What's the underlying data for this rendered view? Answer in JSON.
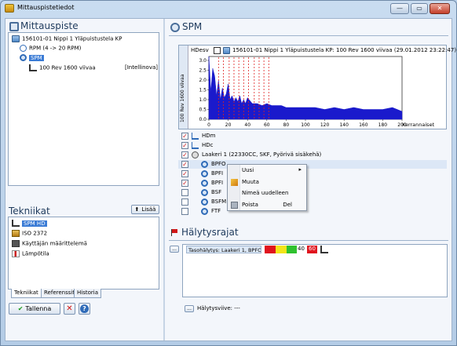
{
  "window": {
    "title": "Mittauspistetiedot",
    "min_glyph": "—",
    "max_glyph": "▭",
    "close_glyph": "✕"
  },
  "measurement_point": {
    "heading": "Mittauspiste",
    "tree": [
      {
        "label": "156101-01  Nippi 1 Yläpuistustela KP",
        "icon": "folder-icon"
      },
      {
        "label": "RPM   (4 -> 20 RPM)",
        "icon": "rpm-icon"
      },
      {
        "label": "SPM",
        "icon": "gear-icon"
      },
      {
        "label": "100 Rev 1600 viivaa",
        "suffix": "[Intellinova]",
        "icon": "chart-icon"
      }
    ]
  },
  "techniques": {
    "heading": "Tekniikat",
    "add_label": "Lisää",
    "items": [
      {
        "label": "SPM HD",
        "icon": "chart-icon",
        "selected": true
      },
      {
        "label": "ISO 2372",
        "icon": "iso-icon",
        "selected": false
      },
      {
        "label": "Käyttäjän määrittelemä",
        "icon": "keyboard-icon",
        "selected": false
      },
      {
        "label": "Lämpötila",
        "icon": "thermometer-icon",
        "selected": false
      }
    ],
    "tabs": [
      "Tekniikat",
      "Referenssit",
      "Historia"
    ]
  },
  "footer": {
    "save_label": "Tallenna",
    "cancel_glyph": "✕",
    "help_glyph": "?"
  },
  "spm": {
    "heading": "SPM",
    "chart_title": "156101-01  Nippi 1 Yläpuistustela KP: 100 Rev 1600 viivaa (29.01.2012 23:22:47)",
    "chart_corner_label": "HDesv",
    "y_axis_label": "100 Rev 1600 viivaa",
    "x_axis_label": "Kerrannaiset",
    "params": [
      {
        "label": "HDm",
        "checked": true,
        "indent": 0,
        "icon": "wave-icon"
      },
      {
        "label": "HDc",
        "checked": true,
        "indent": 0,
        "icon": "wave-icon"
      },
      {
        "label": "Laakeri 1 (22330CC, SKF, Pyörivä sisäkehä)",
        "checked": true,
        "indent": 0,
        "icon": "bearing-icon"
      },
      {
        "label": "BPFO",
        "checked": true,
        "indent": 1,
        "icon": "gear-icon",
        "highlight": true
      },
      {
        "label": "BPFI",
        "checked": true,
        "indent": 1,
        "icon": "gear-icon"
      },
      {
        "label": "BPFI",
        "checked": true,
        "indent": 1,
        "icon": "gear-icon"
      },
      {
        "label": "BSF",
        "checked": false,
        "indent": 1,
        "icon": "gear-icon"
      },
      {
        "label": "BSFM",
        "checked": false,
        "indent": 1,
        "icon": "gear-icon"
      },
      {
        "label": "FTF",
        "checked": false,
        "indent": 1,
        "icon": "gear-icon"
      }
    ],
    "context_menu": [
      {
        "label": "Uusi",
        "shortcut": "",
        "submenu": true,
        "icon": ""
      },
      {
        "label": "Muuta",
        "shortcut": "",
        "submenu": false,
        "icon": "edit-icon"
      },
      {
        "label": "Nimeä uudelleen",
        "shortcut": "",
        "submenu": false,
        "icon": ""
      },
      {
        "label": "Poista",
        "shortcut": "Del",
        "submenu": false,
        "icon": "trash-icon"
      }
    ]
  },
  "alarm": {
    "heading": "Hälytysrajat",
    "row_label": "Tasohälytys: Laakeri 1, BPFO",
    "level_1": "40",
    "level_2": "60",
    "more_glyph": "...",
    "level_caption": "Hälytysviive: ---",
    "colors": {
      "red": "#e0141e",
      "yellow": "#f2e41a",
      "green": "#2fc12f",
      "level_2_bg": "#e0141e"
    }
  },
  "chart_data": {
    "type": "line",
    "title": "156101-01  Nippi 1 Yläpuistustela KP: 100 Rev 1600 viivaa (29.01.2012 23:22:47)",
    "xlabel": "Kerrannaiset",
    "ylabel": "100 Rev 1600 viivaa",
    "xlim": [
      0,
      200
    ],
    "ylim": [
      0,
      3.2
    ],
    "x_ticks": [
      0,
      20,
      40,
      60,
      80,
      100,
      120,
      140,
      160,
      180,
      200
    ],
    "y_ticks": [
      0,
      0.5,
      1.0,
      1.5,
      2.0,
      2.5,
      3.0
    ],
    "series": [
      {
        "color": "#1a1acc",
        "x": [
          0,
          2,
          4,
          6,
          8,
          10,
          12,
          14,
          16,
          18,
          20,
          22,
          24,
          26,
          28,
          30,
          32,
          34,
          36,
          38,
          40,
          45,
          50,
          55,
          60,
          65,
          70,
          75,
          80,
          90,
          100,
          110,
          120,
          130,
          140,
          150,
          160,
          170,
          180,
          190,
          200
        ],
        "y": [
          3.2,
          1.4,
          2.6,
          2.2,
          1.2,
          2.0,
          1.0,
          1.6,
          1.1,
          1.3,
          1.8,
          1.0,
          1.2,
          0.9,
          1.1,
          0.9,
          1.2,
          0.8,
          1.0,
          0.8,
          1.1,
          0.8,
          0.8,
          0.7,
          0.8,
          0.7,
          0.7,
          0.7,
          0.6,
          0.6,
          0.6,
          0.6,
          0.5,
          0.6,
          0.5,
          0.6,
          0.5,
          0.5,
          0.5,
          0.6,
          0.4
        ]
      }
    ],
    "markers_x": [
      10,
      15,
      21,
      26,
      31,
      36,
      41,
      47,
      52,
      57,
      62
    ],
    "markers_color": "#e02020",
    "grid": false,
    "legend": "none"
  }
}
